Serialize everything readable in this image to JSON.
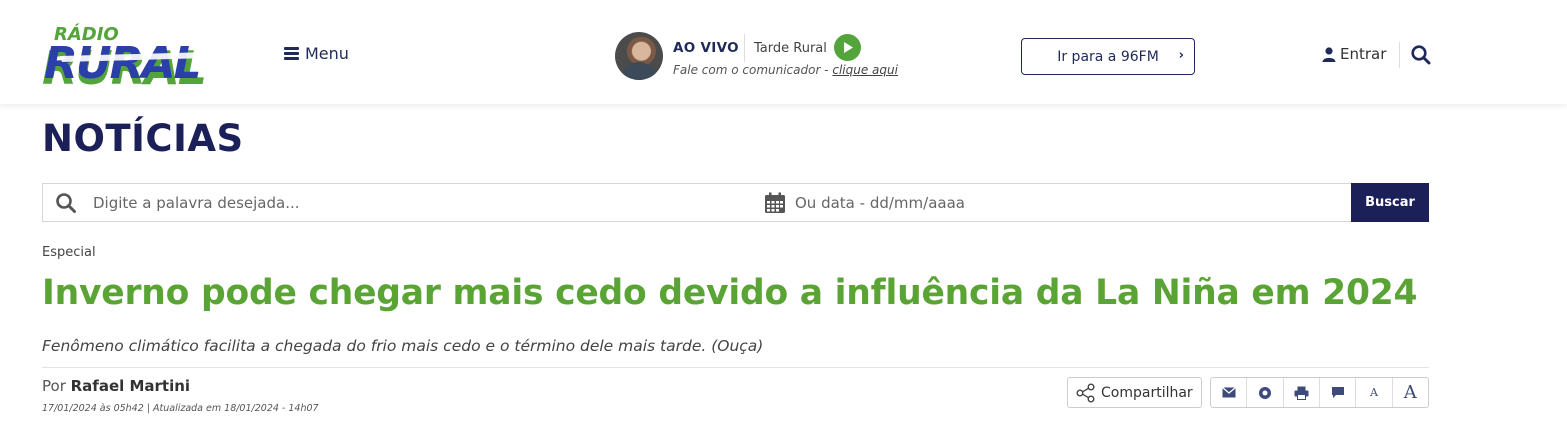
{
  "header": {
    "logo_top": "RÁDIO",
    "logo_main": "RURAL",
    "menu_label": "Menu",
    "live_label": "AO VIVO",
    "program_name": "Tarde Rural",
    "contact_text": "Fale com o comunicador - ",
    "contact_link": "clique aqui",
    "fm_button": "Ir para a 96FM",
    "login_label": "Entrar"
  },
  "page": {
    "title": "NOTÍCIAS"
  },
  "search": {
    "keyword_placeholder": "Digite a palavra desejada...",
    "date_placeholder": "Ou data - dd/mm/aaaa",
    "button_label": "Buscar"
  },
  "article": {
    "category": "Especial",
    "headline": "Inverno pode chegar mais cedo devido a influência da La Niña em 2024",
    "subtitle": "Fenômeno climático facilita a chegada do frio mais cedo e o término dele mais tarde. (Ouça)",
    "byline_prefix": "Por ",
    "author": "Rafael Martini",
    "dates": "17/01/2024 às 05h42 | Atualizada em 18/01/2024 - 14h07",
    "share_label": "Compartilhar",
    "font_small": "A",
    "font_large": "A"
  },
  "colors": {
    "navy": "#1b2158",
    "green": "#5aa435",
    "logo_blue": "#2b3fa8"
  }
}
